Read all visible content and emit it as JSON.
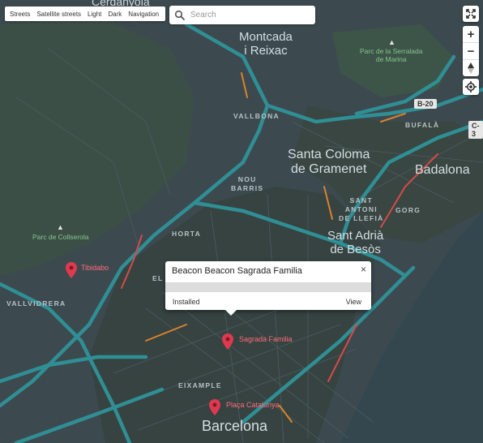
{
  "style_tabs": [
    "Streets",
    "Satellite streets",
    "Light",
    "Dark",
    "Navigation"
  ],
  "search": {
    "placeholder": "Search"
  },
  "controls": {
    "fullscreen": "fullscreen-icon",
    "zoom_in": "+",
    "zoom_out": "−",
    "compass": "compass-icon",
    "geolocate": "geolocate-icon"
  },
  "places": {
    "cerdanyola": "Cerdanyola",
    "montcada": "Montcada\ni Reixac",
    "vallbona": "VALLBONA",
    "serralada": "Parc de la Serralada\nde Marina",
    "santa_coloma": "Santa Coloma\nde Gramenet",
    "badalona": "Badalona",
    "bufala": "BUFALÀ",
    "nou_barris": "NOU\nBARRIS",
    "sant_antoni": "SANT\nANTONI\nDE LLEFIÀ",
    "gorg": "GORG",
    "sant_adria": "Sant Adrià\nde Besòs",
    "collserola": "Parc de Collserola",
    "horta": "HORTA",
    "el": "EL",
    "vallvidrera": "VALLVIDRERA",
    "eixample": "EIXAMPLE",
    "barcelona": "Barcelona"
  },
  "highways": {
    "b20": "B-20",
    "c31": "C-3"
  },
  "pois": [
    {
      "name": "Tibidabo",
      "color": "#e0394f"
    },
    {
      "name": "Sagrada Familia",
      "color": "#e0394f"
    },
    {
      "name": "Plaça Catalunya",
      "color": "#e0394f"
    }
  ],
  "popup": {
    "title": "Beacon Beacon Sagrada Familia",
    "status": "Installed",
    "action": "View",
    "close": "×"
  },
  "colors": {
    "land": "#3c4a4f",
    "highway": "#2f8f95",
    "sea": "#3a4b52",
    "park": "#3f5a48",
    "traffic_orange": "#d9822b",
    "traffic_red": "#d64a4a"
  }
}
